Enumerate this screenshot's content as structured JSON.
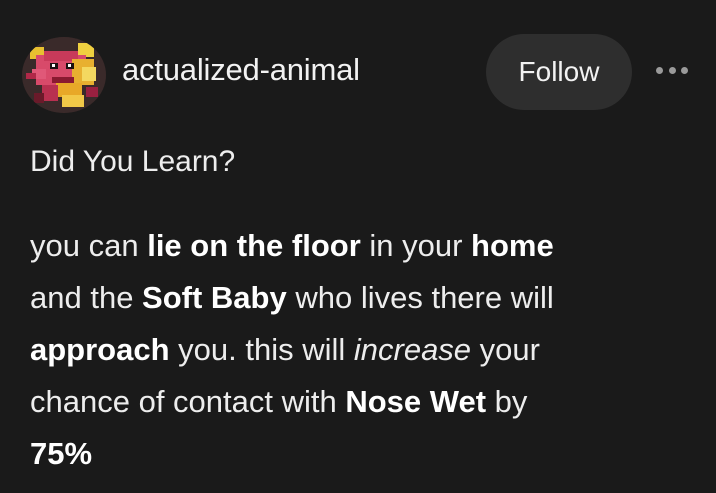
{
  "post": {
    "username": "actualized-animal",
    "follow_label": "Follow",
    "more_icon": "more-horizontal-icon",
    "avatar_icon": "animal-avatar-icon",
    "title": "Did You Learn?",
    "body_lines": [
      [
        {
          "text": "you can ",
          "style": "normal"
        },
        {
          "text": "lie on the floor",
          "style": "bold"
        },
        {
          "text": " in your ",
          "style": "normal"
        },
        {
          "text": "home",
          "style": "bold"
        }
      ],
      [
        {
          "text": "and the ",
          "style": "normal"
        },
        {
          "text": "Soft Baby",
          "style": "bold"
        },
        {
          "text": " who lives there will",
          "style": "normal"
        }
      ],
      [
        {
          "text": "approach",
          "style": "bold"
        },
        {
          "text": " you. this will ",
          "style": "normal"
        },
        {
          "text": "increase",
          "style": "italic"
        },
        {
          "text": " your",
          "style": "normal"
        }
      ],
      [
        {
          "text": "chance of contact with ",
          "style": "normal"
        },
        {
          "text": "Nose Wet",
          "style": "bold"
        },
        {
          "text": " by",
          "style": "normal"
        }
      ],
      [
        {
          "text": "75%",
          "style": "bold"
        }
      ]
    ]
  },
  "colors": {
    "background": "#1a1a1a",
    "button_bg": "#2e2e2e",
    "text": "#ededed"
  }
}
